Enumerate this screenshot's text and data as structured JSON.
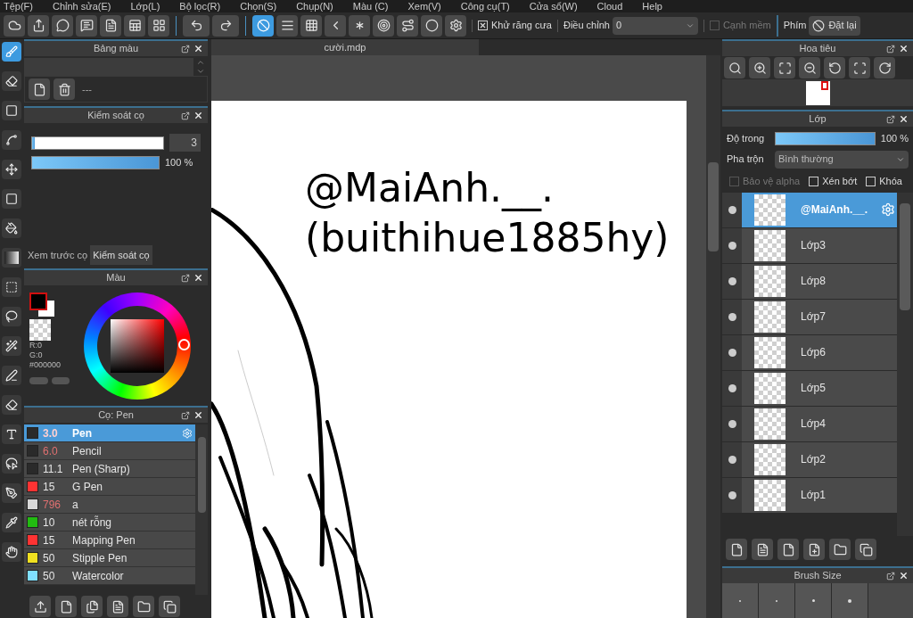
{
  "menu": [
    "Tệp(F)",
    "Chỉnh sửa(E)",
    "Lớp(L)",
    "Bộ lọc(R)",
    "Chọn(S)",
    "Chụp(N)",
    "Màu (C)",
    "Xem(V)",
    "Công cụ(T)",
    "Cửa sổ(W)",
    "Cloud",
    "Help"
  ],
  "toolbar": {
    "guides": [
      {
        "selected": true
      },
      {
        "selected": false
      },
      {
        "selected": false
      },
      {
        "selected": false
      },
      {
        "selected": false
      },
      {
        "selected": false
      },
      {
        "selected": false
      },
      {
        "selected": false
      }
    ],
    "antialias": {
      "label": "Khử răng cưa",
      "checked": true
    },
    "correction": {
      "label": "Điều chỉnh",
      "value": "0"
    },
    "soft_edge": {
      "label": "Cạnh mềm",
      "checked": false,
      "disabled": true
    },
    "key_label": "Phím",
    "reset_button": "Đặt lại"
  },
  "tools": [
    {
      "selected": true
    },
    {
      "selected": false
    },
    {
      "selected": false
    },
    {
      "selected": false
    },
    {
      "selected": false
    },
    {
      "selected": false
    },
    {
      "selected": false
    },
    {
      "selected": false
    },
    {
      "selected": false
    },
    {
      "selected": false
    },
    {
      "selected": false
    },
    {
      "selected": false
    },
    {
      "selected": false
    },
    {
      "selected": false
    },
    {
      "selected": false
    },
    {
      "selected": false
    },
    {
      "selected": false
    },
    {
      "selected": false
    }
  ],
  "palette_panel": {
    "title": "Bảng màu",
    "palette_name": "---"
  },
  "brush_control": {
    "title": "Kiểm soát cọ",
    "size": {
      "level": 0.02,
      "value": "3"
    },
    "opacity": {
      "level": 1,
      "reading": "100 %"
    },
    "tabs": [
      {
        "label": "Xem trước cọ",
        "selected": false
      },
      {
        "label": "Kiểm soát cọ",
        "selected": true
      }
    ]
  },
  "color_panel": {
    "title": "Màu",
    "readouts": [
      "R:0",
      "G:0"
    ],
    "hex": "#000000"
  },
  "brush_panel": {
    "title": "Cọ: Pen",
    "brushes": [
      {
        "size": "3.0",
        "name": "Pen",
        "color": "#2a2a2a",
        "size_highlighted": true,
        "selected": true
      },
      {
        "size": "6.0",
        "name": "Pencil",
        "color": "#2a2a2a",
        "size_highlighted": true,
        "selected": false
      },
      {
        "size": "11.1",
        "name": "Pen (Sharp)",
        "color": "#2a2a2a",
        "size_highlighted": false,
        "selected": false
      },
      {
        "size": "15",
        "name": "G Pen",
        "color": "#ff3333",
        "size_highlighted": false,
        "selected": false
      },
      {
        "size": "796",
        "name": "a",
        "color": "#d8d8d8",
        "size_highlighted": true,
        "selected": false
      },
      {
        "size": "10",
        "name": "nét rỗng",
        "color": "#22bb11",
        "size_highlighted": false,
        "selected": false
      },
      {
        "size": "15",
        "name": "Mapping Pen",
        "color": "#ff3333",
        "size_highlighted": false,
        "selected": false
      },
      {
        "size": "50",
        "name": "Stipple Pen",
        "color": "#f0e020",
        "size_highlighted": false,
        "selected": false
      },
      {
        "size": "50",
        "name": "Watercolor",
        "color": "#80e0ff",
        "size_highlighted": false,
        "selected": false
      }
    ]
  },
  "document_tab": "cười.mdp",
  "canvas": {
    "lines": [
      "@MaiAnh.__.",
      "(buithihue1885hy)"
    ]
  },
  "navigator": {
    "title": "Hoa tiêu"
  },
  "layer_panel": {
    "title": "Lớp",
    "opacity_label": "Độ trong",
    "opacity": {
      "level": 1,
      "reading": "100 %"
    },
    "blend_label": "Pha trộn",
    "blend": "Bình thường",
    "options": [
      {
        "label": "Bảo vệ alpha",
        "checked": false,
        "disabled": true
      },
      {
        "label": "Xén bớt",
        "checked": false,
        "disabled": false
      },
      {
        "label": "Khóa",
        "checked": false,
        "disabled": false
      }
    ],
    "layers": [
      {
        "name": "@MaiAnh.__.",
        "selected": true,
        "visible": true
      },
      {
        "name": "Lớp3",
        "selected": false,
        "visible": true
      },
      {
        "name": "Lớp8",
        "selected": false,
        "visible": true
      },
      {
        "name": "Lớp7",
        "selected": false,
        "visible": true
      },
      {
        "name": "Lớp6",
        "selected": false,
        "visible": true
      },
      {
        "name": "Lớp5",
        "selected": false,
        "visible": true
      },
      {
        "name": "Lớp4",
        "selected": false,
        "visible": true
      },
      {
        "name": "Lớp2",
        "selected": false,
        "visible": true
      },
      {
        "name": "Lớp1",
        "selected": false,
        "visible": true
      }
    ]
  },
  "brush_size_panel": {
    "title": "Brush Size"
  }
}
